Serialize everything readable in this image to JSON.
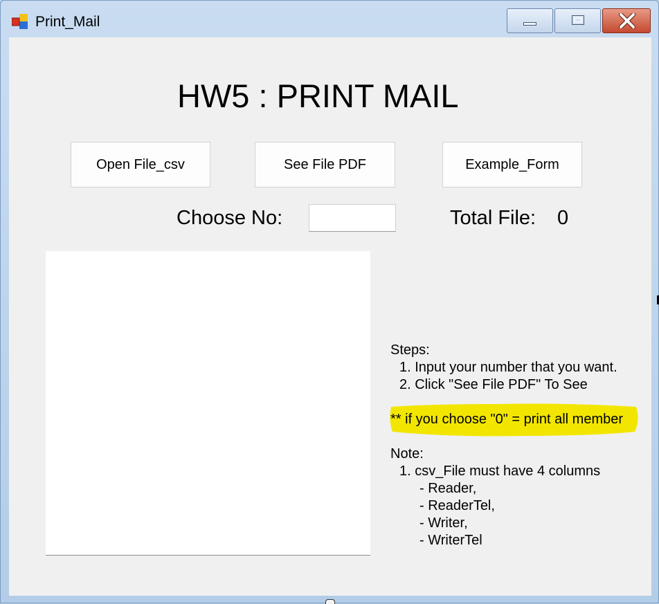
{
  "window": {
    "title": "Print_Mail",
    "icon": "winforms-app-icon"
  },
  "header": {
    "title": "HW5 : PRINT MAIL"
  },
  "buttons": {
    "open": "Open File_csv",
    "see_pdf": "See File PDF",
    "example": "Example_Form"
  },
  "form": {
    "choose_label": "Choose No:",
    "choose_value": "",
    "total_label": "Total File:",
    "total_value": "0"
  },
  "steps": {
    "heading": "Steps:",
    "items": [
      "1. Input your number that you want.",
      "2. Click \"See File PDF\" To See"
    ],
    "highlight": "** if you choose \"0\" = print all member"
  },
  "note": {
    "heading": "Note:",
    "items": [
      "1. csv_File must have 4 columns",
      "- Reader,",
      "- ReaderTel,",
      "- Writer,",
      "- WriterTel"
    ]
  },
  "colors": {
    "highlight": "#f2e600",
    "client_bg": "#f0f0f0",
    "close_button": "#c44a30"
  }
}
